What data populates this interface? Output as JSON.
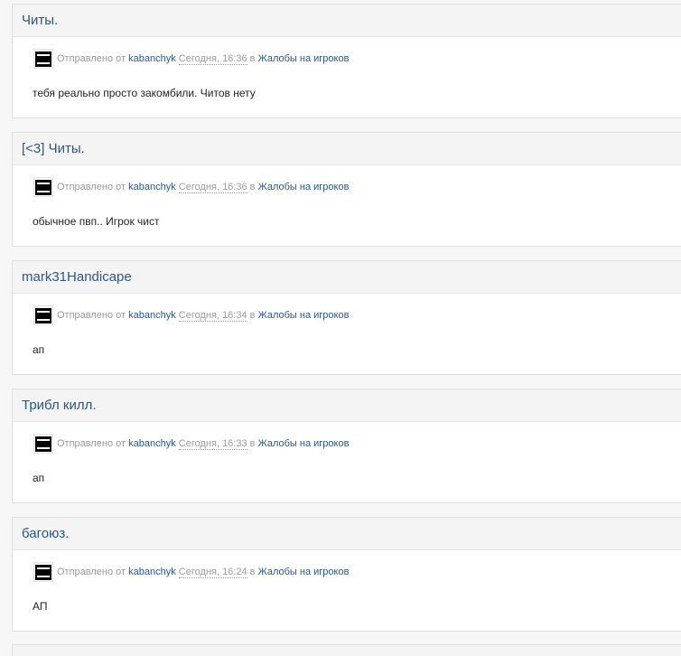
{
  "posts": [
    {
      "title": "Читы.",
      "meta": {
        "prefix": "Отправлено от",
        "author": "kabanchyk",
        "time": "Сегодня, 16:36",
        "in": "в",
        "forum": "Жалобы на игроков"
      },
      "snippet": "тебя реально просто закомбили. Читов нету"
    },
    {
      "title": "[<3] Читы.",
      "meta": {
        "prefix": "Отправлено от",
        "author": "kabanchyk",
        "time": "Сегодня, 16:36",
        "in": "в",
        "forum": "Жалобы на игроков"
      },
      "snippet": "обычное пвп.. Игрок чист"
    },
    {
      "title": "mark31Handicape",
      "meta": {
        "prefix": "Отправлено от",
        "author": "kabanchyk",
        "time": "Сегодня, 16:34",
        "in": "в",
        "forum": "Жалобы на игроков"
      },
      "snippet": "ап"
    },
    {
      "title": "Трибл килл.",
      "meta": {
        "prefix": "Отправлено от",
        "author": "kabanchyk",
        "time": "Сегодня, 16:33",
        "in": "в",
        "forum": "Жалобы на игроков"
      },
      "snippet": "ап"
    },
    {
      "title": "багоюз.",
      "meta": {
        "prefix": "Отправлено от",
        "author": "kabanchyk",
        "time": "Сегодня, 16:24",
        "in": "в",
        "forum": "Жалобы на игроков"
      },
      "snippet": "АП"
    }
  ],
  "icons": {
    "avatar": "avatar-icon"
  },
  "colors": {
    "link": "#2c5687",
    "muted": "#9a9a9a",
    "text": "#222222",
    "panel": "#f4f4f4",
    "border": "#e0e0e0"
  }
}
